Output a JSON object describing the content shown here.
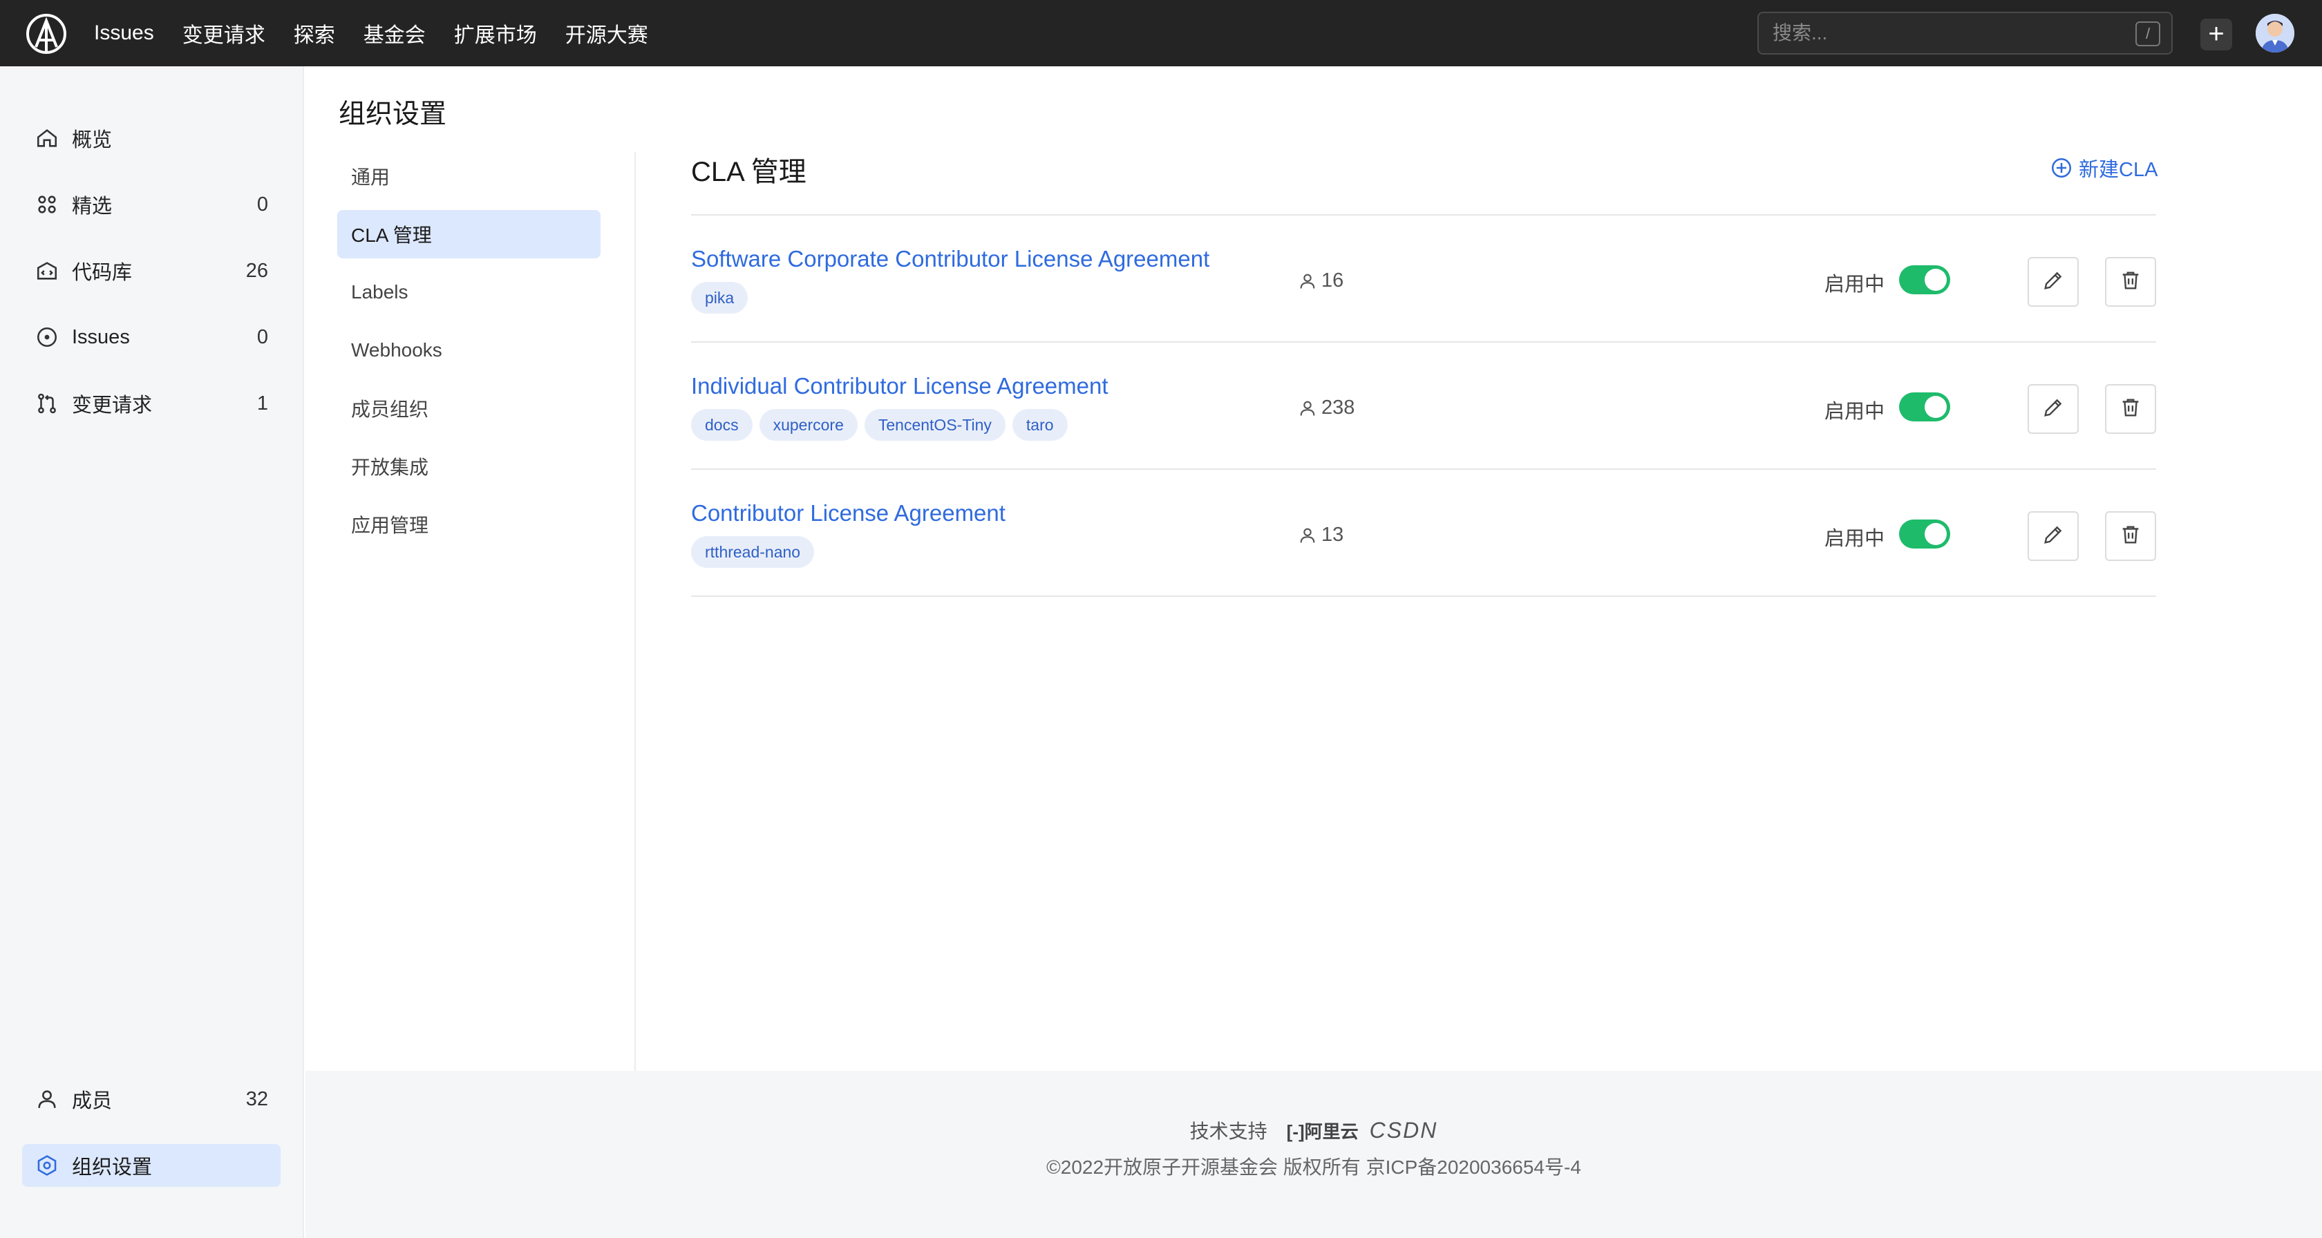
{
  "header": {
    "logo": "openatom-logo",
    "nav": [
      "Issues",
      "变更请求",
      "探索",
      "基金会",
      "扩展市场",
      "开源大赛"
    ],
    "search_placeholder": "搜索...",
    "search_shortcut": "/",
    "plus": "+"
  },
  "sidebar": {
    "items": [
      {
        "label": "概览",
        "count": "",
        "icon": "home-icon"
      },
      {
        "label": "精选",
        "count": "0",
        "icon": "grid-icon"
      },
      {
        "label": "代码库",
        "count": "26",
        "icon": "repo-icon"
      },
      {
        "label": "Issues",
        "count": "0",
        "icon": "issue-icon"
      },
      {
        "label": "变更请求",
        "count": "1",
        "icon": "pull-request-icon"
      }
    ],
    "bottom_items": [
      {
        "label": "成员",
        "count": "32",
        "icon": "user-icon"
      },
      {
        "label": "组织设置",
        "count": "",
        "icon": "settings-icon",
        "active": true
      }
    ]
  },
  "main": {
    "title": "组织设置",
    "subnav": [
      "通用",
      "CLA 管理",
      "Labels",
      "Webhooks",
      "成员组织",
      "开放集成",
      "应用管理"
    ],
    "subnav_active": "CLA 管理",
    "section_title": "CLA 管理",
    "new_button": "新建CLA",
    "rows": [
      {
        "name": "Software Corporate Contributor License Agreement",
        "tags": [
          "pika"
        ],
        "members": "16",
        "status": "启用中",
        "enabled": true
      },
      {
        "name": "Individual Contributor License Agreement",
        "tags": [
          "docs",
          "xupercore",
          "TencentOS-Tiny",
          "taro"
        ],
        "members": "238",
        "status": "启用中",
        "enabled": true
      },
      {
        "name": "Contributor License Agreement",
        "tags": [
          "rtthread-nano"
        ],
        "members": "13",
        "status": "启用中",
        "enabled": true
      }
    ]
  },
  "footer": {
    "support": "技术支持",
    "brand1": "阿里云",
    "brand2": "CSDN",
    "copyright": "©2022开放原子开源基金会 版权所有 京ICP备2020036654号-4"
  },
  "colors": {
    "accent": "#2f6bde",
    "toggle_on": "#1ebb6b",
    "topbar": "#242424"
  }
}
